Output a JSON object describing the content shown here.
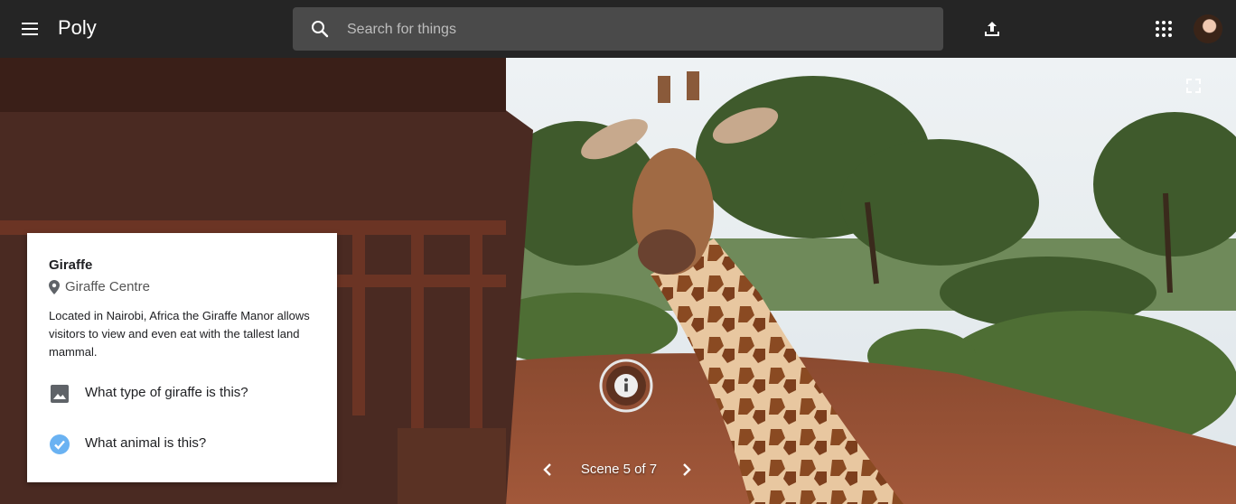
{
  "app": {
    "title": "Poly"
  },
  "search": {
    "placeholder": "Search for things",
    "value": ""
  },
  "icons": {
    "menu": "menu-icon",
    "search": "search-icon",
    "upload": "upload-icon",
    "apps": "apps-grid-icon",
    "fullscreen": "fullscreen-icon",
    "info": "info-icon",
    "prev": "chevron-left-icon",
    "next": "chevron-right-icon",
    "location": "location-pin-icon",
    "image": "image-icon",
    "check": "check-circle-icon"
  },
  "card": {
    "title": "Giraffe",
    "location": "Giraffe Centre",
    "description": "Located in Nairobi, Africa the Giraffe Manor allows visitors to view and even eat with the tallest land mammal.",
    "questions": [
      {
        "label": "What type of giraffe is this?",
        "icon": "image-icon",
        "answered": false
      },
      {
        "label": "What animal is this?",
        "icon": "check-circle-icon",
        "answered": true
      }
    ]
  },
  "scene_nav": {
    "label": "Scene 5 of 7"
  },
  "colors": {
    "topbar": "#252525",
    "search_bg": "#4a4a4a",
    "check_accent": "#6ab2f2",
    "card_bg": "#ffffff"
  }
}
